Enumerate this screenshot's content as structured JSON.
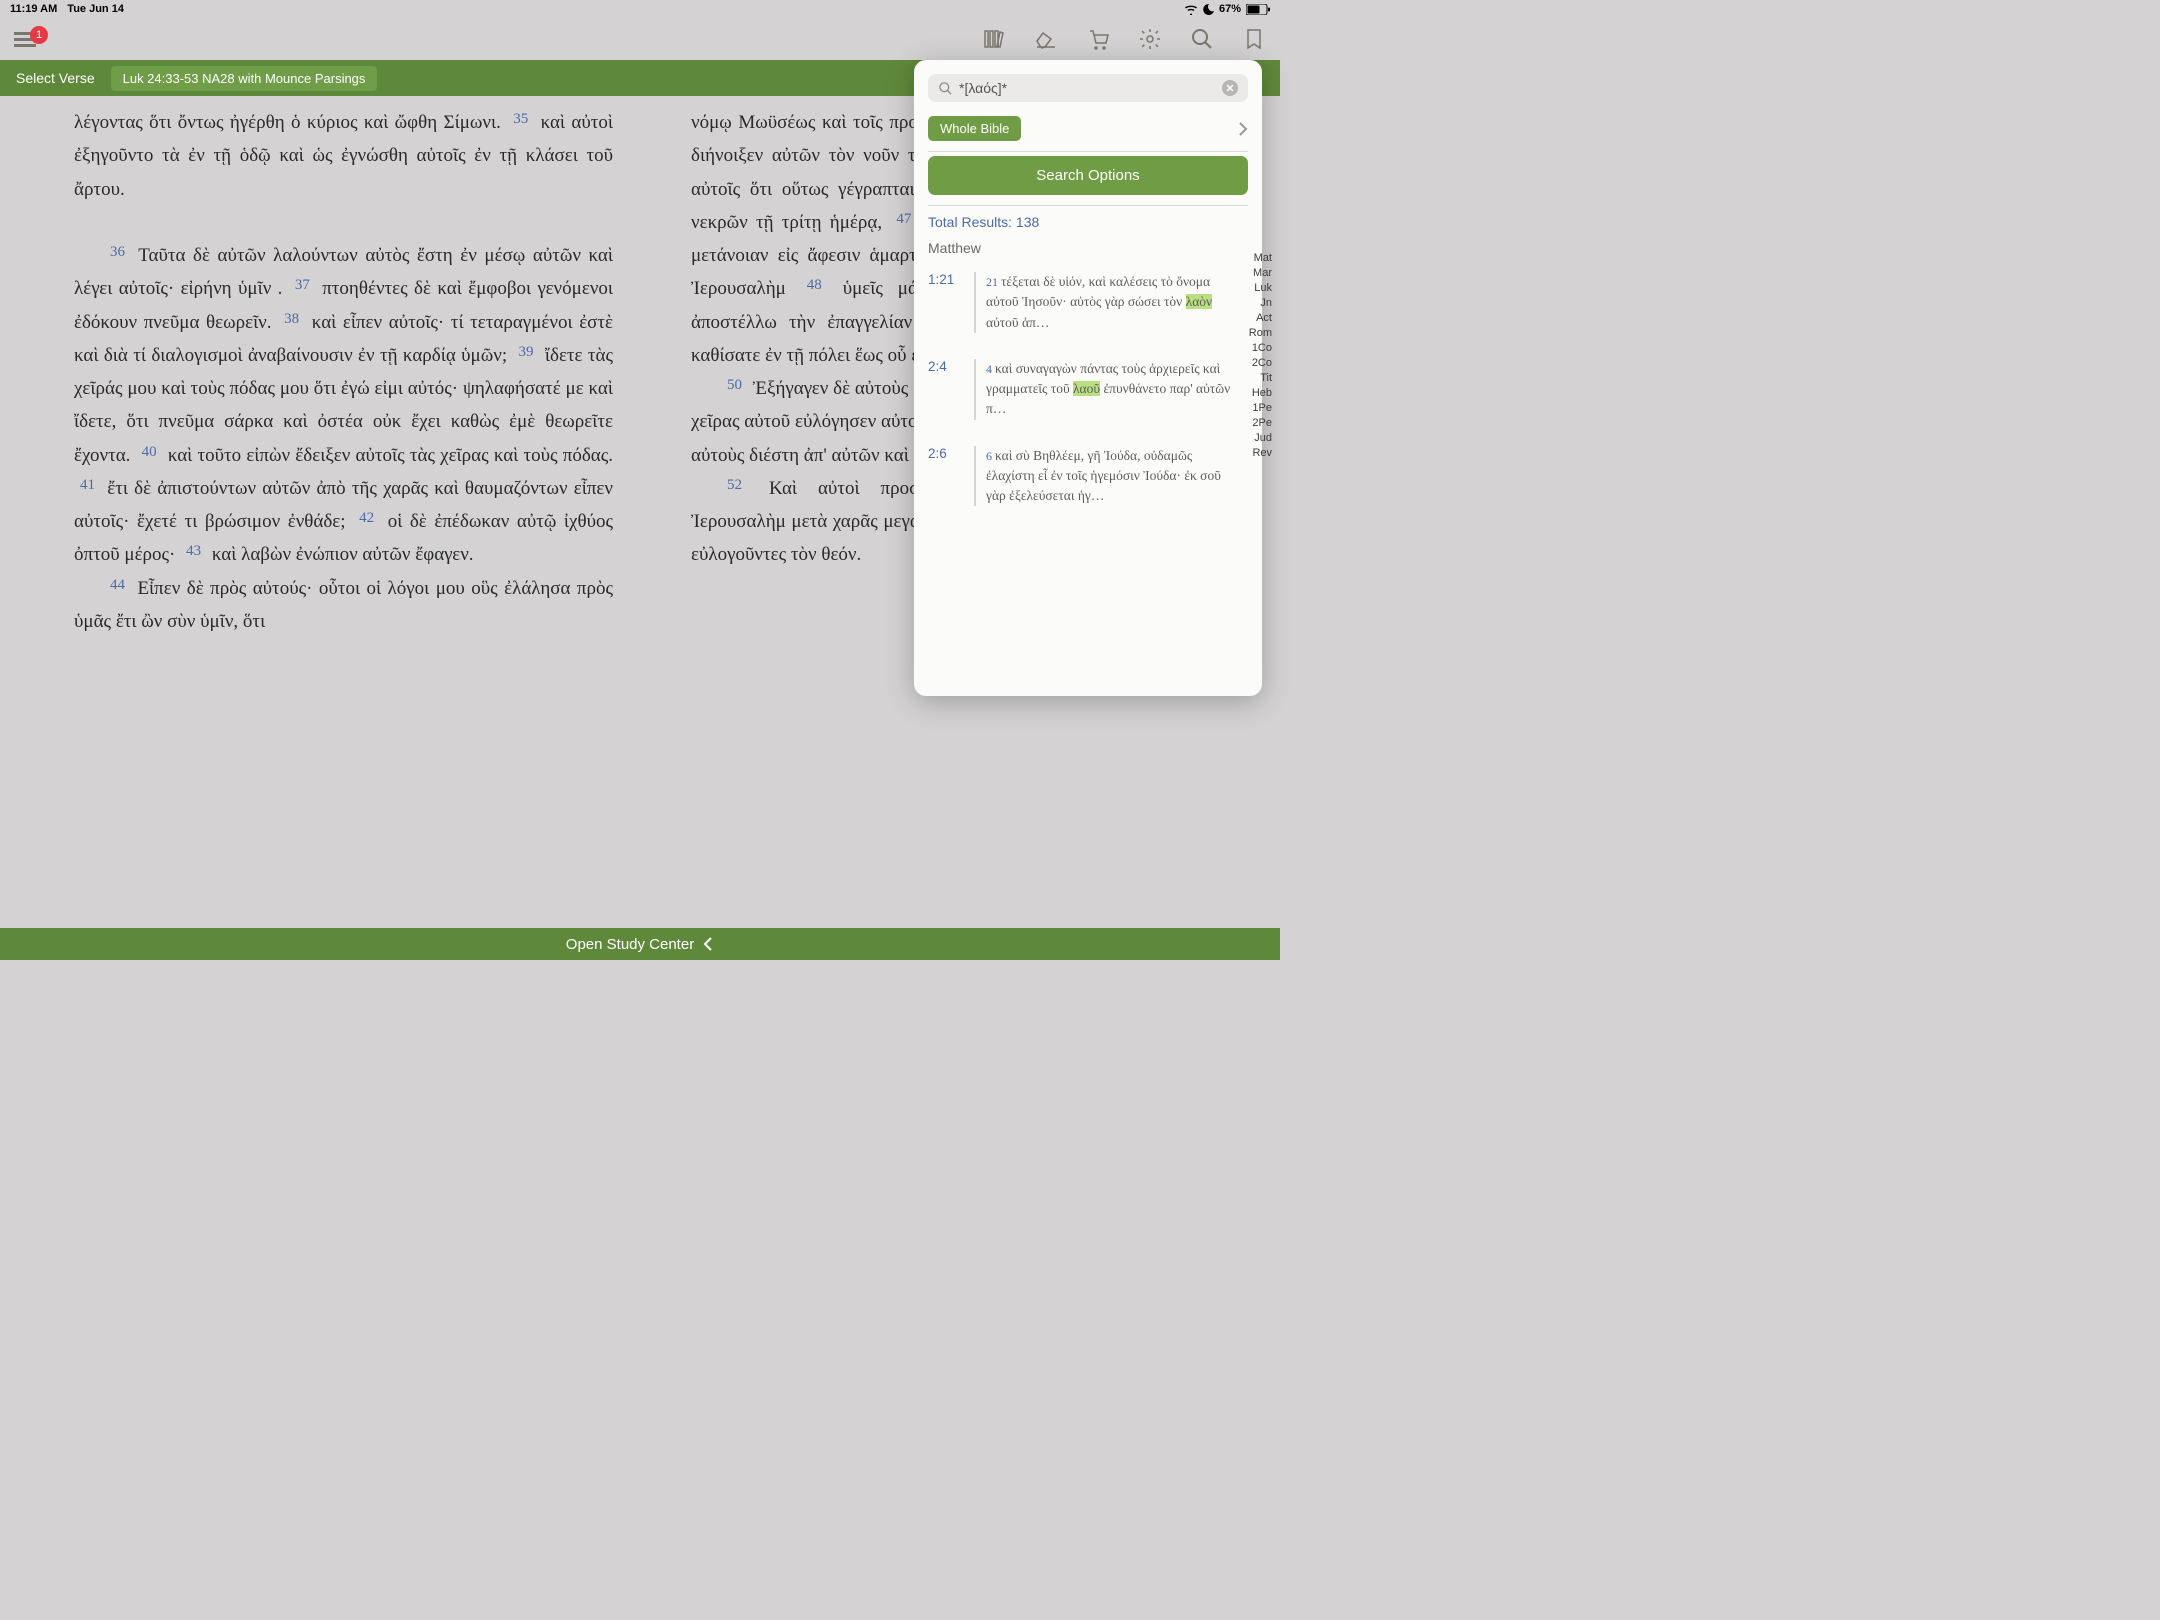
{
  "status": {
    "time": "11:19 AM",
    "date": "Tue Jun 14",
    "battery": "67%"
  },
  "toolbar": {
    "badge": "1"
  },
  "greenbar": {
    "select_verse": "Select Verse",
    "reference": "Luk 24:33-53 NA28 with Mounce Parsings"
  },
  "text": {
    "col1": {
      "pre": "λέγοντας ὅτι ὄντως ἠγέρθη ὁ κύριος καὶ ὤφθη Σίμωνι.",
      "v35": "καὶ αὐτοὶ ἐξηγοῦντο τὰ ἐν τῇ ὁδῷ καὶ ὡς ἐγνώσθη αὐτοῖς ἐν τῇ κλάσει τοῦ ἄρτου.",
      "v36": "Ταῦτα δὲ αὐτῶν λαλούντων αὐτὸς ἔστη ἐν μέσῳ αὐτῶν καὶ λέγει αὐτοῖς· εἰρήνη ὑμῖν .",
      "v37": "πτοηθέντες δὲ καὶ ἔμφοβοι γενόμενοι ἐδόκουν πνεῦμα θεωρεῖν.",
      "v38": "καὶ εἶπεν αὐτοῖς· τί τεταραγμένοι ἐστὲ καὶ διὰ τί διαλογισμοὶ ἀναβαίνουσιν ἐν τῇ καρδίᾳ ὑμῶν;",
      "v39": "ἴδετε τὰς χεῖράς μου καὶ τοὺς πόδας μου ὅτι ἐγώ εἰμι αὐτός· ψηλαφήσατέ με καὶ ἴδετε, ὅτι πνεῦμα σάρκα καὶ ὀστέα οὐκ ἔχει καθὼς ἐμὲ θεωρεῖτε ἔχοντα.",
      "v40": "καὶ τοῦτο εἰπὼν ἔδειξεν αὐτοῖς τὰς χεῖρας καὶ τοὺς πόδας.",
      "v41": "ἔτι δὲ ἀπιστούντων αὐτῶν ἀπὸ τῆς χαρᾶς καὶ θαυμαζόντων εἶπεν αὐτοῖς· ἔχετέ τι βρώσιμον ἐνθάδε;",
      "v42": "οἱ δὲ ἐπέδωκαν αὐτῷ ἰχθύος ὀπτοῦ μέρος·",
      "v43": "καὶ λαβὼν ἐνώπιον αὐτῶν ἔφαγεν.",
      "v44": "Εἶπεν δὲ πρὸς αὐτούς· οὗτοι οἱ λόγοι μου οὓς ἐλάλησα πρὸς ὑμᾶς ἔτι ὢν σὺν ὑμῖν, ὅτι"
    },
    "col2": {
      "pre": "νόμῳ Μωϋσέως καὶ τοῖς προφήταις καὶ ψαλμοῖς περὶ ἐμοῦ.",
      "v45": "τότε διήνοιξεν αὐτῶν τὸν νοῦν τοῦ συνιέναι τὰς γραφάς·",
      "v46": "καὶ εἶπεν αὐτοῖς ὅτι οὕτως γέγραπται παθεῖν τὸν χριστὸν καὶ ἀναστῆναι ἐκ νεκρῶν τῇ τρίτῃ ἡμέρᾳ,",
      "v47": "καὶ κηρυχθῆναι ἐπὶ τῷ ὀνόματι αὐτοῦ μετάνοιαν εἰς ἄφεσιν ἁμαρτιῶν εἰς πάντα τὰ ἔθνη. ἀρξάμενοι ἀπὸ Ἰερουσαλὴμ",
      "v48": "ὑμεῖς μάρτυρες τούτων.",
      "v49": "καὶ [ἰδοὺ] ἐγὼ ἀποστέλλω τὴν ἐπαγγελίαν τοῦ πατρός μου ἐφ' ὑμᾶς· ὑμεῖς δὲ καθίσατε ἐν τῇ πόλει ἕως οὗ ἐνδύσησθε ἐξ ὕψους δύναμιν.",
      "v50": "Ἐξήγαγεν δὲ αὐτοὺς [ἔξω] ἕως πρὸς Βηθανίαν, καὶ ἐπάρας τὰς χεῖρας αὐτοῦ εὐλόγησεν αὐτούς.",
      "v51": "καὶ ἐγένετο ἐν τῷ εὐλογεῖν αὐτὸν αὐτοὺς διέστη ἀπ' αὐτῶν καὶ ἀνεφέρετο εἰς τὸν οὐρανόν.",
      "v52": "Καὶ αὐτοὶ προσκυνήσαντες αὐτὸν ὑπέστρεψαν εἰς Ἰερουσαλὴμ μετὰ χαρᾶς μεγάλης",
      "v53": "καὶ ἦσαν διὰ παντὸς ἐν τῷ ἱερῷ εὐλογοῦντες τὸν θεόν."
    }
  },
  "search": {
    "query": "*[λαός]*",
    "scope": "Whole Bible",
    "options_label": "Search Options",
    "total_label": "Total Results: 138",
    "book_header": "Matthew",
    "results": [
      {
        "ref": "1:21",
        "vn": "21",
        "pre": "τέξεται δὲ υἱόν, καὶ καλέσεις τὸ ὄνομα αὐτοῦ Ἰησοῦν· αὐτὸς γὰρ σώσει τὸν ",
        "hl": "λαὸν",
        "post": " αὐτοῦ ἀπ…"
      },
      {
        "ref": "2:4",
        "vn": "4",
        "pre": "καὶ συναγαγὼν πάντας τοὺς ἀρχιερεῖς καὶ γραμματεῖς τοῦ ",
        "hl": "λαοῦ",
        "post": " ἐπυνθάνετο παρ' αὐτῶν π…"
      },
      {
        "ref": "2:6",
        "vn": "6",
        "pre": "καὶ σὺ Βηθλέεμ, γῆ Ἰούδα, οὐδαμῶς ἐλαχίστη εἶ ἐν τοῖς ἡγεμόσιν Ἰούδα· ἐκ σοῦ γὰρ ἐξελεύσεται ἡγ…",
        "hl": "",
        "post": ""
      }
    ],
    "index": [
      "Mat",
      "Mar",
      "Luk",
      "Jn",
      "Act",
      "Rom",
      "1Co",
      "2Co",
      "Tit",
      "Heb",
      "1Pe",
      "2Pe",
      "Jud",
      "Rev"
    ]
  },
  "footer": {
    "label": "Open Study Center"
  }
}
